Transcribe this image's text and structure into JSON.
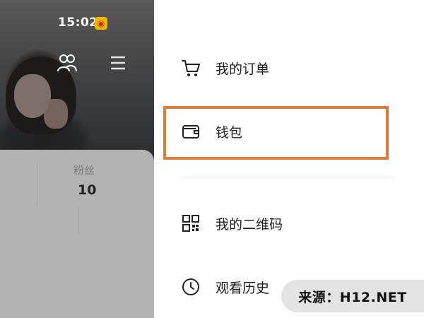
{
  "status_bar": {
    "time": "15:02",
    "app_icon": "weibo-icon"
  },
  "profile": {
    "header_icons": [
      "friends-icon",
      "menu-icon"
    ],
    "stats": {
      "fans_label": "粉丝",
      "fans_value": "10"
    }
  },
  "drawer": {
    "items": [
      {
        "label": "我的订单",
        "icon": "shopping-cart-icon"
      },
      {
        "label": "钱包",
        "icon": "wallet-icon",
        "highlighted": true
      },
      {
        "label": "我的二维码",
        "icon": "qr-code-icon"
      },
      {
        "label": "观看历史",
        "icon": "clock-icon"
      }
    ]
  },
  "watermark": {
    "text": "来源：H12.NET"
  },
  "colors": {
    "highlight": "#e07a3c",
    "overlay": "#b3b3b3",
    "watermark_bg": "#e3e3e3"
  }
}
